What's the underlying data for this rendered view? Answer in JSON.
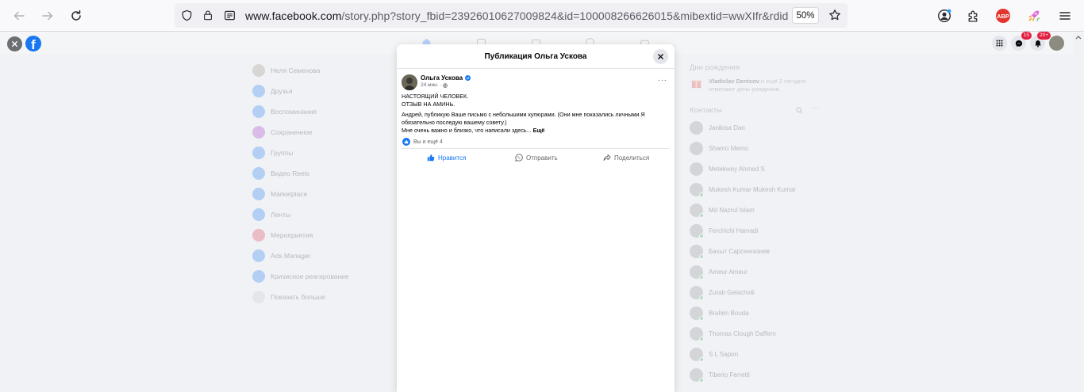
{
  "browser": {
    "url_host": "www.facebook.com",
    "url_rest": "/story.php?story_fbid=23926010627009824&id=100008266626015&mibextid=wwXIfr&rdid",
    "zoom": "50%",
    "abp_label": "ABP"
  },
  "fb": {
    "logo": "f",
    "messenger_badge": "15",
    "notifications_badge": "20+",
    "left_nav": [
      {
        "label": "Неля Семенова",
        "icon": "avatar",
        "color": "#9b8f86"
      },
      {
        "label": "Друзья",
        "icon": "friends-icon",
        "color": "#1877f2"
      },
      {
        "label": "Воспоминания",
        "icon": "memories-icon",
        "color": "#1877f2"
      },
      {
        "label": "Сохраненное",
        "icon": "saved-icon",
        "color": "#a033c5"
      },
      {
        "label": "Группы",
        "icon": "groups-icon",
        "color": "#1877f2"
      },
      {
        "label": "Видео Reels",
        "icon": "video-icon",
        "color": "#1877f2"
      },
      {
        "label": "Marketplace",
        "icon": "marketplace-icon",
        "color": "#1877f2"
      },
      {
        "label": "Ленты",
        "icon": "feeds-icon",
        "color": "#1877f2"
      },
      {
        "label": "Мероприятия",
        "icon": "events-icon",
        "color": "#e4334f"
      },
      {
        "label": "Ads Manager",
        "icon": "ads-icon",
        "color": "#1877f2"
      },
      {
        "label": "Кризисное реагирование",
        "icon": "crisis-icon",
        "color": "#1877f2"
      },
      {
        "label": "Показать больше",
        "icon": "chevron-down-icon",
        "color": "#c8cbd0"
      }
    ],
    "birthdays": {
      "title": "Дни рождения",
      "name": "Vladislav Denisov",
      "rest": " и ещё 2 сегодня отмечают день рождения."
    },
    "contacts_title": "Контакты",
    "contacts": [
      {
        "name": "Janikisa Dan",
        "online": false
      },
      {
        "name": "Shamo Memo",
        "online": false
      },
      {
        "name": "Metekwey Ahmed S",
        "online": false
      },
      {
        "name": "Mukesh Kumar Mukesh Kumar",
        "online": true
      },
      {
        "name": "Md Nazrul Islam",
        "online": true
      },
      {
        "name": "Ferchichi Hamadi",
        "online": true
      },
      {
        "name": "Бахыт Сарсенгазиев",
        "online": true
      },
      {
        "name": "Ameur Ameur",
        "online": true
      },
      {
        "name": "Zurab Gelachvili",
        "online": true
      },
      {
        "name": "Brahim Bouda",
        "online": true
      },
      {
        "name": "Thomas Clough Daffern",
        "online": true
      },
      {
        "name": "S L Sapon",
        "online": true
      },
      {
        "name": "Tiberio Ferretti",
        "online": true
      }
    ]
  },
  "modal": {
    "title": "Публикация Ольга Ускова",
    "author": "Ольга Ускова",
    "time": "24 мин.",
    "time_sep": "·",
    "lines": [
      "НАСТОЯЩИЙ ЧЕЛОВЕК.",
      "ОТЗЫВ НА АМИНЬ.",
      "Андрей, публикую Ваше письмо с небольшими купюрами. (Они мне показались личными.Я",
      "обязательно последую вашему совету.)",
      "Мне очень важно и близко, что написали здесь..."
    ],
    "more_label": "Ещё",
    "reactions_text": "Вы и ещё 4",
    "actions": {
      "like": "Нравится",
      "send": "Отправить",
      "share": "Поделиться"
    }
  }
}
